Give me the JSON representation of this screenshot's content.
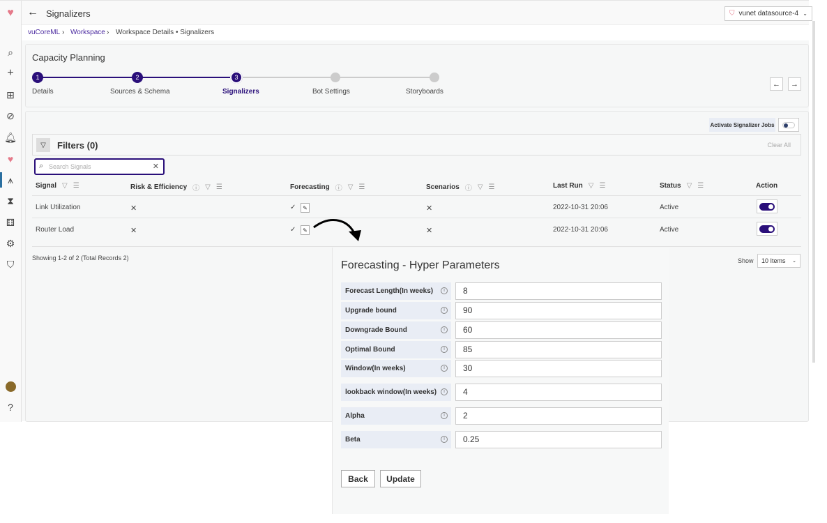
{
  "header": {
    "title": "Signalizers",
    "datasource": "vunet datasource-4"
  },
  "breadcrumb": {
    "root": "vuCoreML",
    "workspace": "Workspace",
    "current": "Workspace Details • Signalizers"
  },
  "wizard": {
    "title": "Capacity Planning",
    "steps": [
      {
        "num": "1",
        "label": "Details"
      },
      {
        "num": "2",
        "label": "Sources & Schema"
      },
      {
        "num": "3",
        "label": "Signalizers"
      },
      {
        "num": "4",
        "label": "Bot Settings"
      },
      {
        "num": "5",
        "label": "Storyboards"
      }
    ],
    "active_step": 3
  },
  "activate_label": "Activate Signalizer Jobs",
  "filters": {
    "title": "Filters (0)",
    "clear": "Clear All",
    "search_placeholder": "Search Signals"
  },
  "table": {
    "columns": [
      "Signal",
      "Risk & Efficiency",
      "Forecasting",
      "Scenarios",
      "Last Run",
      "Status",
      "Action"
    ],
    "rows": [
      {
        "signal": "Link Utilization",
        "risk": "✕",
        "forecast": "✓",
        "scenarios": "✕",
        "last_run": "2022-10-31 20:06",
        "status": "Active"
      },
      {
        "signal": "Router Load",
        "risk": "✕",
        "forecast": "✓",
        "scenarios": "✕",
        "last_run": "2022-10-31 20:06",
        "status": "Active"
      }
    ]
  },
  "pagination": {
    "summary": "Showing 1-2 of 2 (Total Records 2)",
    "show": "Show",
    "page_size": "10 Items"
  },
  "panel": {
    "title": "Forecasting - Hyper Parameters",
    "params": [
      {
        "label": "Forecast Length(In weeks)",
        "value": "8"
      },
      {
        "label": "Upgrade bound",
        "value": "90"
      },
      {
        "label": "Downgrade Bound",
        "value": "60"
      },
      {
        "label": "Optimal Bound",
        "value": "85"
      },
      {
        "label": "Window(In weeks)",
        "value": "30"
      },
      {
        "label": "lookback window(In weeks)",
        "value": "4"
      },
      {
        "label": "Alpha",
        "value": "2"
      },
      {
        "label": "Beta",
        "value": "0.25"
      }
    ],
    "back": "Back",
    "update": "Update"
  },
  "colors": {
    "accent": "#2a0f7a",
    "link": "#4b2aa0"
  }
}
